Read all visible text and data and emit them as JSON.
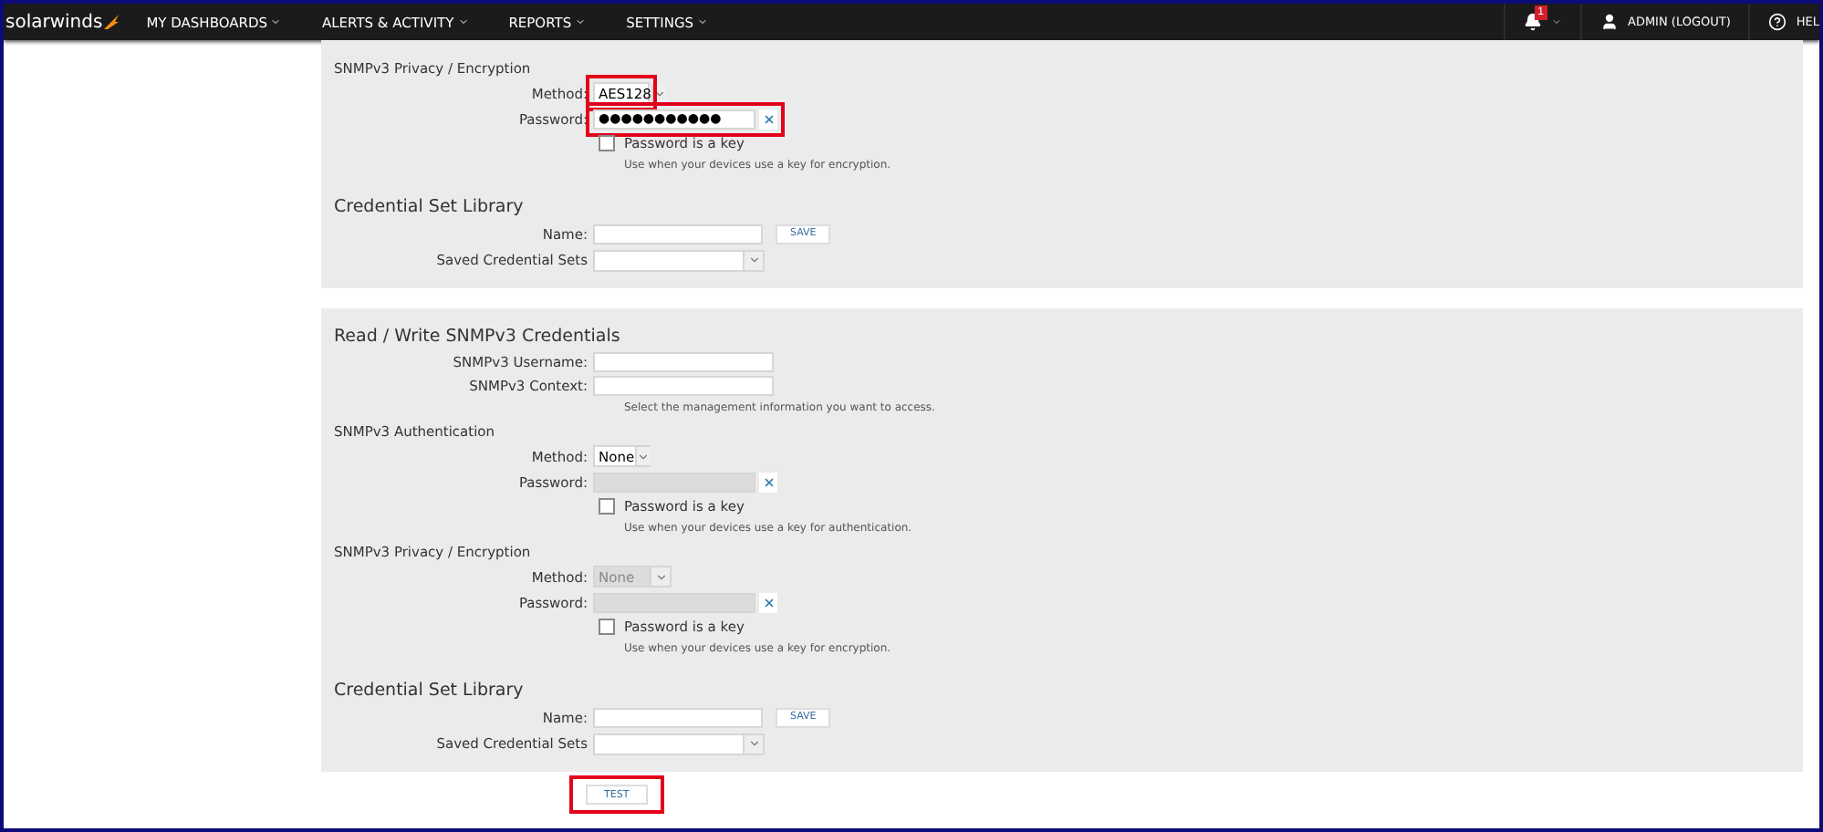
{
  "nav": {
    "brand": "solarwinds",
    "menus": [
      {
        "label": "MY DASHBOARDS"
      },
      {
        "label": "ALERTS & ACTIVITY"
      },
      {
        "label": "REPORTS"
      },
      {
        "label": "SETTINGS"
      }
    ],
    "notification_count": "1",
    "user": "ADMIN (LOGOUT)",
    "help": "HEL"
  },
  "panels": [
    {
      "rows": [
        {
          "kind": "subheading",
          "text": "SNMPv3 Privacy / Encryption"
        },
        {
          "kind": "select",
          "label": "Method:",
          "value": "AES128",
          "disabled": false,
          "highlighted": true
        },
        {
          "kind": "password",
          "label": "Password:",
          "value": "●●●●●●●●●●●",
          "disabled": false,
          "highlighted": true
        },
        {
          "kind": "checkbox",
          "label": "Password is a key",
          "checked": false
        },
        {
          "kind": "hint",
          "text": "Use when your devices use a key for encryption."
        },
        {
          "kind": "title",
          "text": "Credential Set Library"
        },
        {
          "kind": "save",
          "label": "Name:",
          "button": "SAVE"
        },
        {
          "kind": "select",
          "label": "Saved Credential Sets",
          "disabled": false
        }
      ]
    },
    {
      "rows": [
        {
          "kind": "title",
          "text": "Read / Write SNMPv3 Credentials"
        },
        {
          "kind": "text",
          "label": "SNMPv3 Username:"
        },
        {
          "kind": "text",
          "label": "SNMPv3 Context:"
        },
        {
          "kind": "hint",
          "text": "Select the management information you want to access."
        },
        {
          "kind": "subheading",
          "text": "SNMPv3 Authentication"
        },
        {
          "kind": "select",
          "label": "Method:",
          "value": "None",
          "disabled": false,
          "highlighted": false
        },
        {
          "kind": "password",
          "label": "Password:",
          "disabled": true,
          "highlighted": false
        },
        {
          "kind": "checkbox",
          "label": "Password is a key",
          "checked": false
        },
        {
          "kind": "hint",
          "text": "Use when your devices use a key for authentication."
        },
        {
          "kind": "subheading",
          "text": "SNMPv3 Privacy / Encryption"
        },
        {
          "kind": "select",
          "label": "Method:",
          "value": "None",
          "disabled": true,
          "highlighted": false
        },
        {
          "kind": "password",
          "label": "Password:",
          "disabled": true,
          "highlighted": false
        },
        {
          "kind": "checkbox",
          "label": "Password is a key",
          "checked": false
        },
        {
          "kind": "hint",
          "text": "Use when your devices use a key for encryption."
        },
        {
          "kind": "title",
          "text": "Credential Set Library"
        },
        {
          "kind": "save",
          "label": "Name:",
          "button": "SAVE"
        },
        {
          "kind": "select",
          "label": "Saved Credential Sets",
          "disabled": false
        }
      ]
    }
  ],
  "test_button": {
    "label": "TEST",
    "highlighted": true
  }
}
